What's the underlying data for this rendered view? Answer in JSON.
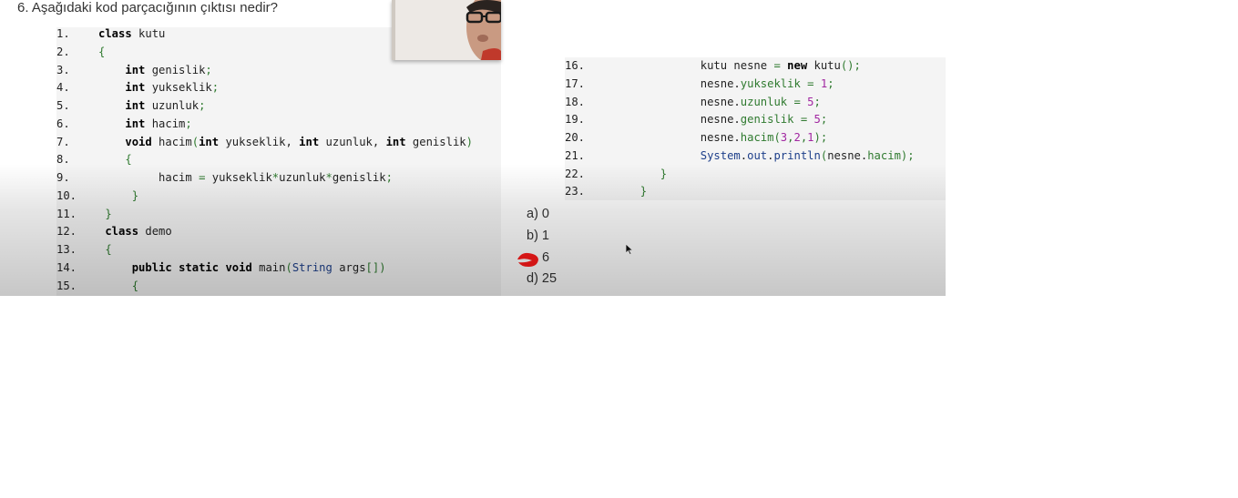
{
  "question": "6. Aşağıdaki kod parçacığının çıktısı nedir?",
  "code_left": [
    {
      "n": "1.",
      "indent": "",
      "parts": [
        {
          "t": "class",
          "c": "kw"
        },
        {
          "t": " kutu",
          "c": "pl"
        }
      ]
    },
    {
      "n": "2.",
      "indent": "",
      "parts": [
        {
          "t": "{",
          "c": "gr"
        }
      ]
    },
    {
      "n": "3.",
      "indent": "    ",
      "parts": [
        {
          "t": "int",
          "c": "kw"
        },
        {
          "t": " genislik",
          "c": "pl"
        },
        {
          "t": ";",
          "c": "gr"
        }
      ]
    },
    {
      "n": "4.",
      "indent": "    ",
      "parts": [
        {
          "t": "int",
          "c": "kw"
        },
        {
          "t": " yukseklik",
          "c": "pl"
        },
        {
          "t": ";",
          "c": "gr"
        }
      ]
    },
    {
      "n": "5.",
      "indent": "    ",
      "parts": [
        {
          "t": "int",
          "c": "kw"
        },
        {
          "t": " uzunluk",
          "c": "pl"
        },
        {
          "t": ";",
          "c": "gr"
        }
      ]
    },
    {
      "n": "6.",
      "indent": "    ",
      "parts": [
        {
          "t": "int",
          "c": "kw"
        },
        {
          "t": " hacim",
          "c": "pl"
        },
        {
          "t": ";",
          "c": "gr"
        }
      ]
    },
    {
      "n": "7.",
      "indent": "    ",
      "parts": [
        {
          "t": "void",
          "c": "kw"
        },
        {
          "t": " hacim",
          "c": "pl"
        },
        {
          "t": "(",
          "c": "gr"
        },
        {
          "t": "int",
          "c": "kw"
        },
        {
          "t": " yukseklik, ",
          "c": "pl"
        },
        {
          "t": "int",
          "c": "kw"
        },
        {
          "t": " uzunluk, ",
          "c": "pl"
        },
        {
          "t": "int",
          "c": "kw"
        },
        {
          "t": " genislik",
          "c": "pl"
        },
        {
          "t": ")",
          "c": "gr"
        }
      ]
    },
    {
      "n": "8.",
      "indent": "    ",
      "parts": [
        {
          "t": "{",
          "c": "gr"
        }
      ]
    },
    {
      "n": "9.",
      "indent": "         ",
      "parts": [
        {
          "t": "hacim ",
          "c": "pl"
        },
        {
          "t": "=",
          "c": "gr"
        },
        {
          "t": " yukseklik",
          "c": "pl"
        },
        {
          "t": "*",
          "c": "gr"
        },
        {
          "t": "uzunluk",
          "c": "pl"
        },
        {
          "t": "*",
          "c": "gr"
        },
        {
          "t": "genislik",
          "c": "pl"
        },
        {
          "t": ";",
          "c": "gr"
        }
      ]
    },
    {
      "n": "10.",
      "indent": "     ",
      "parts": [
        {
          "t": "}",
          "c": "gr"
        }
      ]
    },
    {
      "n": "11.",
      "indent": " ",
      "parts": [
        {
          "t": "}",
          "c": "gr"
        }
      ]
    },
    {
      "n": "12.",
      "indent": " ",
      "parts": [
        {
          "t": "class",
          "c": "kw"
        },
        {
          "t": " demo",
          "c": "pl"
        }
      ]
    },
    {
      "n": "13.",
      "indent": " ",
      "parts": [
        {
          "t": "{",
          "c": "gr"
        }
      ]
    },
    {
      "n": "14.",
      "indent": "     ",
      "parts": [
        {
          "t": "public",
          "c": "kw"
        },
        {
          "t": " ",
          "c": "pl"
        },
        {
          "t": "static",
          "c": "kw"
        },
        {
          "t": " ",
          "c": "pl"
        },
        {
          "t": "void",
          "c": "kw"
        },
        {
          "t": " main",
          "c": "pl"
        },
        {
          "t": "(",
          "c": "gr"
        },
        {
          "t": "String",
          "c": "ty"
        },
        {
          "t": " args",
          "c": "pl"
        },
        {
          "t": "[])",
          "c": "gr"
        }
      ]
    },
    {
      "n": "15.",
      "indent": "     ",
      "parts": [
        {
          "t": "{",
          "c": "gr"
        }
      ]
    }
  ],
  "code_right": [
    {
      "n": "16.",
      "indent": "              ",
      "parts": [
        {
          "t": "kutu nesne ",
          "c": "pl"
        },
        {
          "t": "=",
          "c": "gr"
        },
        {
          "t": " ",
          "c": "pl"
        },
        {
          "t": "new",
          "c": "kw"
        },
        {
          "t": " kutu",
          "c": "pl"
        },
        {
          "t": "();",
          "c": "gr"
        }
      ]
    },
    {
      "n": "17.",
      "indent": "              ",
      "parts": [
        {
          "t": "nesne.",
          "c": "pl"
        },
        {
          "t": "yukseklik",
          "c": "gr"
        },
        {
          "t": " ",
          "c": "pl"
        },
        {
          "t": "=",
          "c": "gr"
        },
        {
          "t": " ",
          "c": "pl"
        },
        {
          "t": "1",
          "c": "pu"
        },
        {
          "t": ";",
          "c": "gr"
        }
      ]
    },
    {
      "n": "18.",
      "indent": "              ",
      "parts": [
        {
          "t": "nesne.",
          "c": "pl"
        },
        {
          "t": "uzunluk",
          "c": "gr"
        },
        {
          "t": " ",
          "c": "pl"
        },
        {
          "t": "=",
          "c": "gr"
        },
        {
          "t": " ",
          "c": "pl"
        },
        {
          "t": "5",
          "c": "pu"
        },
        {
          "t": ";",
          "c": "gr"
        }
      ]
    },
    {
      "n": "19.",
      "indent": "              ",
      "parts": [
        {
          "t": "nesne.",
          "c": "pl"
        },
        {
          "t": "genislik",
          "c": "gr"
        },
        {
          "t": " ",
          "c": "pl"
        },
        {
          "t": "=",
          "c": "gr"
        },
        {
          "t": " ",
          "c": "pl"
        },
        {
          "t": "5",
          "c": "pu"
        },
        {
          "t": ";",
          "c": "gr"
        }
      ]
    },
    {
      "n": "20.",
      "indent": "              ",
      "parts": [
        {
          "t": "nesne.",
          "c": "pl"
        },
        {
          "t": "hacim",
          "c": "gr"
        },
        {
          "t": "(",
          "c": "gr"
        },
        {
          "t": "3",
          "c": "pu"
        },
        {
          "t": ",",
          "c": "gr"
        },
        {
          "t": "2",
          "c": "pu"
        },
        {
          "t": ",",
          "c": "gr"
        },
        {
          "t": "1",
          "c": "pu"
        },
        {
          "t": ");",
          "c": "gr"
        }
      ]
    },
    {
      "n": "21.",
      "indent": "              ",
      "parts": [
        {
          "t": "System",
          "c": "ty"
        },
        {
          "t": ".",
          "c": "pl"
        },
        {
          "t": "out",
          "c": "ty"
        },
        {
          "t": ".",
          "c": "pl"
        },
        {
          "t": "println",
          "c": "ty"
        },
        {
          "t": "(",
          "c": "gr"
        },
        {
          "t": "nesne.",
          "c": "pl"
        },
        {
          "t": "hacim",
          "c": "gr"
        },
        {
          "t": ");",
          "c": "gr"
        }
      ]
    },
    {
      "n": "22.",
      "indent": "        ",
      "parts": [
        {
          "t": "}",
          "c": "gr"
        }
      ]
    },
    {
      "n": "23.",
      "indent": "     ",
      "parts": [
        {
          "t": "}",
          "c": "gr"
        }
      ]
    }
  ],
  "options": [
    {
      "label": "a) 0"
    },
    {
      "label": "b) 1"
    },
    {
      "label": "6"
    },
    {
      "label": "d) 25"
    }
  ],
  "colors": {
    "keyword": "#000000",
    "type": "#1d3f8a",
    "symbol": "#2f7a2f",
    "number": "#a127a1",
    "scribble": "#ff1a1a"
  },
  "icons": {
    "cursor": "mouse-pointer-icon",
    "scribble": "red-marker-scribble"
  }
}
